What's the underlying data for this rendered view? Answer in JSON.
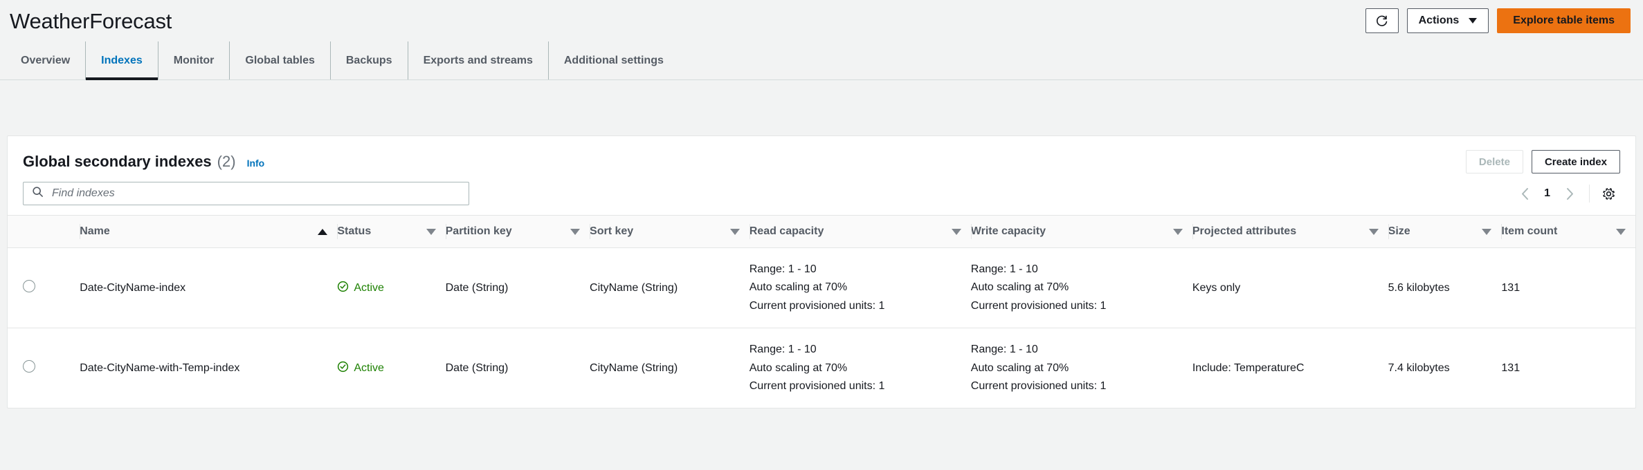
{
  "header": {
    "title": "WeatherForecast",
    "refresh_icon": "refresh-icon",
    "actions_label": "Actions",
    "explore_label": "Explore table items"
  },
  "tabs": [
    {
      "label": "Overview",
      "active": false
    },
    {
      "label": "Indexes",
      "active": true
    },
    {
      "label": "Monitor",
      "active": false
    },
    {
      "label": "Global tables",
      "active": false
    },
    {
      "label": "Backups",
      "active": false
    },
    {
      "label": "Exports and streams",
      "active": false
    },
    {
      "label": "Additional settings",
      "active": false
    }
  ],
  "panel": {
    "title": "Global secondary indexes",
    "count": "(2)",
    "info_label": "Info",
    "delete_label": "Delete",
    "create_label": "Create index",
    "search_placeholder": "Find indexes",
    "search_value": "",
    "search_icon": "search-icon",
    "pagination": {
      "prev_icon": "chevron-left-icon",
      "page": "1",
      "next_icon": "chevron-right-icon",
      "settings_icon": "gear-icon"
    },
    "columns": [
      {
        "label": "Name",
        "sort": "asc-active"
      },
      {
        "label": "Status",
        "sort": "desc"
      },
      {
        "label": "Partition key",
        "sort": "desc"
      },
      {
        "label": "Sort key",
        "sort": "desc"
      },
      {
        "label": "Read capacity",
        "sort": "desc"
      },
      {
        "label": "Write capacity",
        "sort": "desc"
      },
      {
        "label": "Projected attributes",
        "sort": "desc"
      },
      {
        "label": "Size",
        "sort": "desc"
      },
      {
        "label": "Item count",
        "sort": "desc"
      }
    ],
    "rows": [
      {
        "selected": false,
        "name": "Date-CityName-index",
        "status": "Active",
        "status_icon": "check-circle-icon",
        "partition_key": "Date (String)",
        "sort_key": "CityName (String)",
        "read_capacity": [
          "Range: 1 - 10",
          "Auto scaling at 70%",
          "Current provisioned units: 1"
        ],
        "write_capacity": [
          "Range: 1 - 10",
          "Auto scaling at 70%",
          "Current provisioned units: 1"
        ],
        "projected_attributes": "Keys only",
        "size": "5.6 kilobytes",
        "item_count": "131"
      },
      {
        "selected": false,
        "name": "Date-CityName-with-Temp-index",
        "status": "Active",
        "status_icon": "check-circle-icon",
        "partition_key": "Date (String)",
        "sort_key": "CityName (String)",
        "read_capacity": [
          "Range: 1 - 10",
          "Auto scaling at 70%",
          "Current provisioned units: 1"
        ],
        "write_capacity": [
          "Range: 1 - 10",
          "Auto scaling at 70%",
          "Current provisioned units: 1"
        ],
        "projected_attributes": "Include: TemperatureC",
        "size": "7.4 kilobytes",
        "item_count": "131"
      }
    ]
  },
  "colors": {
    "accent_orange": "#ec7211",
    "link_blue": "#0073bb",
    "status_green": "#1d8102",
    "page_bg": "#f2f3f3"
  }
}
